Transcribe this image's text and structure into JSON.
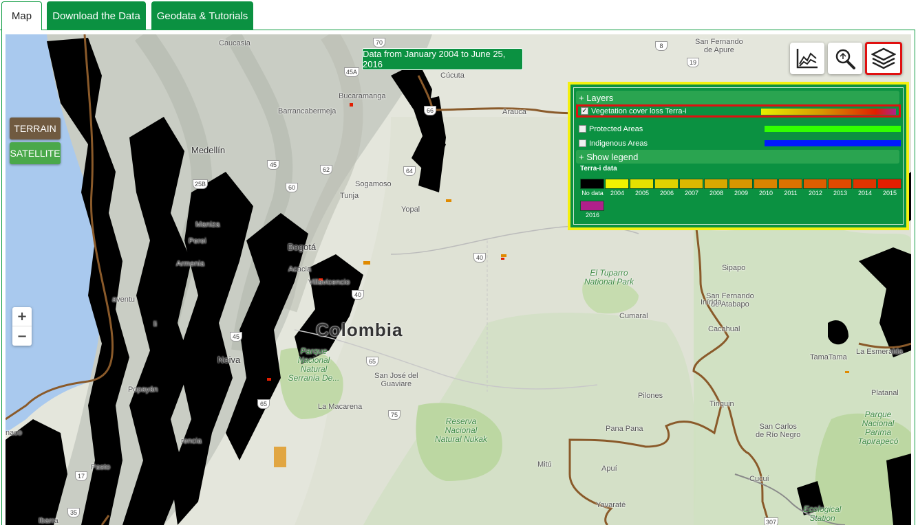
{
  "tabs": [
    {
      "label": "Map",
      "active": true
    },
    {
      "label": "Download the Data",
      "active": false
    },
    {
      "label": "Geodata & Tutorials",
      "active": false
    }
  ],
  "map": {
    "date_badge": "Data from January 2004 to June 25, 2016",
    "controls": {
      "terrain_label": "TERRAIN",
      "satellite_label": "SATELLITE",
      "zoom_in": "+",
      "zoom_out": "−"
    },
    "tools": [
      {
        "name": "chart-icon"
      },
      {
        "name": "zoom-search-icon"
      },
      {
        "name": "layers-icon"
      }
    ],
    "places": {
      "colombia": "Colombia",
      "medellin": "Medellín",
      "bogota": "Bogotá",
      "neiva": "Neiva",
      "popayan": "Popayán",
      "pasto": "Pasto",
      "manizales": "Maniza",
      "pereira": "Perei",
      "armenia": "Armenia",
      "cali": "li",
      "buenaventura": "aventu",
      "ibarra": "Ibarra",
      "tumaco": "naco",
      "bucaramanga": "Bucaramanga",
      "barrancabermeja": "Barrancabermeja",
      "sogamoso": "Sogamoso",
      "tunja": "Tunja",
      "yopal": "Yopal",
      "villavicencio": "Villavicencio",
      "acacias": "Acacia",
      "arauca": "Arauca",
      "cucuta": "Cúcuta",
      "caucasia": "Caucasia",
      "san_fernando_apure": "San Fernando\nde Apure",
      "sipapo": "Sipapo",
      "san_fernando_atabapo": "San Fernando\nde Atabapo",
      "inirida": "Inírida",
      "cacahual": "Cacahual",
      "cumaral": "Cumaral",
      "tamatama": "TamaTama",
      "la_esmeralda": "La Esmeralda",
      "platanal": "Platanal",
      "san_carlos": "San Carlos\nde Río Negro",
      "pilones": "Pilones",
      "tiriquin": "Tiriquin",
      "pana_pana": "Pana Pana",
      "san_jose": "San José del\nGuaviare",
      "la_macarena": "La Macarena",
      "mitu": "Mitú",
      "apui": "Apuí",
      "cucui": "Cucuí",
      "yavarate": "Yavaraté",
      "florencia": "rencia",
      "el_tuparro": "El Tuparro\nNational Park",
      "parque_picachos": "Parque\nNacional\nNatural\nSerranía De...",
      "nukak": "Reserva\nNacional\nNatural Nukak",
      "parima": "Parque\nNacional\nParima\nTapirapecó",
      "ecologica": "Ecological\nStation"
    },
    "road_shields": [
      "70",
      "45A",
      "66",
      "8",
      "19",
      "45",
      "62",
      "60",
      "64",
      "25B",
      "40",
      "40",
      "45",
      "65",
      "65",
      "75",
      "17",
      "35",
      "307"
    ]
  },
  "layers_panel": {
    "layers_header": "+ Layers",
    "layers": [
      {
        "label": "Vegetation cover loss Terra-i",
        "checked": true
      },
      {
        "label": "Protected Areas",
        "checked": false
      },
      {
        "label": "Indigenous Areas",
        "checked": false
      }
    ],
    "legend_header": "+ Show legend",
    "legend_title": "Terra-i data",
    "legend": [
      {
        "label": "No data",
        "color": "#000000"
      },
      {
        "label": "2004",
        "color": "#f2f200"
      },
      {
        "label": "2005",
        "color": "#e6e000"
      },
      {
        "label": "2006",
        "color": "#e0d200"
      },
      {
        "label": "2007",
        "color": "#dcb800"
      },
      {
        "label": "2008",
        "color": "#d9a800"
      },
      {
        "label": "2009",
        "color": "#d89600"
      },
      {
        "label": "2010",
        "color": "#d98400"
      },
      {
        "label": "2011",
        "color": "#db7200"
      },
      {
        "label": "2012",
        "color": "#dd5e00"
      },
      {
        "label": "2013",
        "color": "#df4a00"
      },
      {
        "label": "2014",
        "color": "#e03400"
      },
      {
        "label": "2015",
        "color": "#e21e00"
      },
      {
        "label": "2016",
        "color": "#b0208a"
      }
    ]
  },
  "colors": {
    "brand_green": "#0b9141",
    "highlight_yellow": "#f4f010",
    "highlight_red": "#e01010",
    "protected_bar": "#33ff00",
    "indigenous_bar": "#0019ff",
    "border_line": "#8a5a2a"
  }
}
